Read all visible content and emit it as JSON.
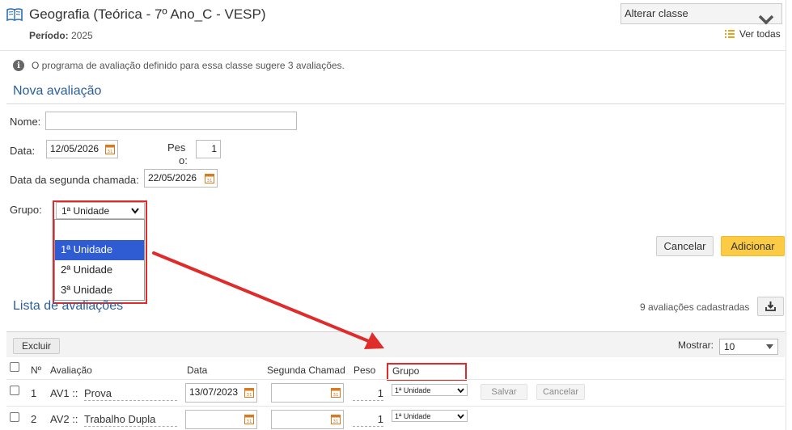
{
  "header": {
    "title": "Geografia (Teórica - 7º Ano_C - VESP)",
    "periodo_label": "Período:",
    "periodo_value": "2025",
    "alterar_classe": "Alterar classe",
    "ver_todas": "Ver todas"
  },
  "info": {
    "message": "O programa de avaliação definido para essa classe sugere 3 avaliações."
  },
  "nova": {
    "title": "Nova avaliação",
    "nome_label": "Nome:",
    "nome_value": "",
    "data_label": "Data:",
    "data_value": "12/05/2026",
    "peso_label_1": "Pes",
    "peso_label_2": "o:",
    "peso_value": "1",
    "segunda_label": "Data da segunda chamada:",
    "segunda_value": "22/05/2026",
    "grupo_label": "Grupo:",
    "grupo_selected": "1ª Unidade",
    "grupo_options": [
      "",
      "1ª Unidade",
      "2ª Unidade",
      "3ª Unidade"
    ],
    "cancelar": "Cancelar",
    "adicionar": "Adicionar"
  },
  "lista": {
    "title": "Lista de avaliações",
    "count": "9 avaliações cadastradas",
    "excluir": "Excluir",
    "mostrar_label": "Mostrar:",
    "mostrar_value": "10",
    "columns": {
      "num": "Nº",
      "avaliacao": "Avaliação",
      "data": "Data",
      "segunda": "Segunda Chamad",
      "peso": "Peso",
      "grupo": "Grupo"
    },
    "rows": [
      {
        "num": "1",
        "code": "AV1 ::",
        "name": "Prova",
        "data": "13/07/2023",
        "segunda": "",
        "peso": "1",
        "grupo": "1ª Unidade",
        "salvar": "Salvar",
        "cancelar": "Cancelar"
      },
      {
        "num": "2",
        "code": "AV2 ::",
        "name": "Trabalho Dupla",
        "data": "",
        "segunda": "",
        "peso": "1",
        "grupo": "1ª Unidade"
      }
    ]
  },
  "colors": {
    "accent_blue": "#2a5ea0",
    "annotation_red": "#e02b2b",
    "primary_button": "#fccb45",
    "selected_option": "#2f5bd3"
  }
}
